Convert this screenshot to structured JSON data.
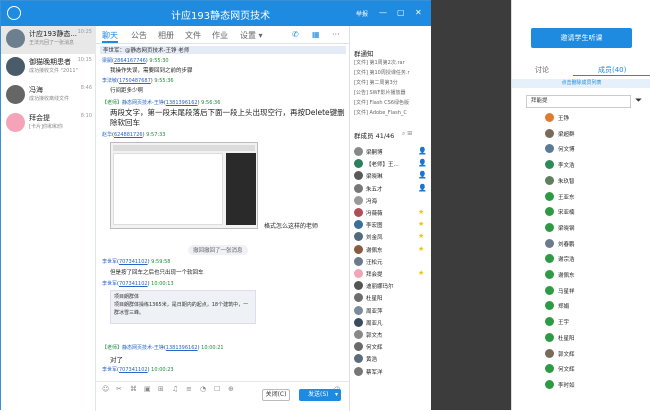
{
  "window": {
    "title": "计应193静态网页技术",
    "status_label": "举报",
    "minimize": "—",
    "maximize": "▢",
    "close": "✕"
  },
  "conversations": [
    {
      "name": "计应193静态...",
      "time": "10:25",
      "preview": "王法元回了一张消息",
      "avatar_color": "#6b7f8f"
    },
    {
      "name": "御猫晚期患者",
      "time": "10:15",
      "preview": "成功接收文件 \"2011\"",
      "avatar_color": "#4a5b6a"
    },
    {
      "name": "冯海",
      "time": "8:46",
      "preview": "成功接收离线文件",
      "avatar_color": "#666666"
    },
    {
      "name": "拜会提",
      "time": "8:10",
      "preview": "[卡片]你和和你",
      "avatar_color": "#f4a3b8"
    }
  ],
  "chat_tabs": [
    "聊天",
    "公告",
    "相册",
    "文件",
    "作业",
    "设置 ▾"
  ],
  "chat_tab_active": 0,
  "announcement": "李世军：@静态网页技术-王铮 老师",
  "messages": [
    {
      "name": "梁嗣",
      "id": "2864167746",
      "time": "9:55:30",
      "text": "我操作失误，需要回到之前的步骤"
    },
    {
      "name": "李法敏",
      "id": "1750487687",
      "time": "9:55:36",
      "text": "行间距多少啊"
    },
    {
      "tag": "【老师】",
      "name": "静态网页技术-王铮",
      "id": "1381396162",
      "time": "9:56:36",
      "text": "两段文字，第一段末尾段落后下面一段上头出现空行，再按Delete键删除软回车"
    },
    {
      "name": "赵华",
      "id": "624881726",
      "time": "9:57:33",
      "text": ""
    },
    {
      "name": "李世军",
      "id": "707341102",
      "time": "9:59:58",
      "text": "但是按了回车之后也只出现一个软回车"
    },
    {
      "name": "李世军",
      "id": "707341102",
      "time": "10:00:13",
      "text": ""
    },
    {
      "tag": "【老师】",
      "name": "静态网页技术-王铮",
      "id": "1381396162",
      "time": "10:00:21",
      "text": "对了"
    },
    {
      "name": "李世军",
      "id": "707341102",
      "time": "10:00:23",
      "text": ""
    }
  ],
  "image_caption": "格式怎么这样的老师",
  "recall_notice": "撤回撤回了一张消息",
  "quote_text_1": "项目朗群体",
  "quote_text_2": "项目朗群体操练1365米，是日期内的起点，18个建筑中，一群冰雪三峰。",
  "toolbar_icons": [
    "☺",
    "✂",
    "⌘",
    "▣",
    "⊞",
    "♫",
    "≡",
    "◔",
    "☐",
    "⊕",
    "◷"
  ],
  "buttons": {
    "close": "关闭(C)",
    "send": "发送(S)"
  },
  "side": {
    "notice_title": "群通知",
    "notices": [
      "[文件] 第1周第2次.rar",
      "[文件] 第10周授课任务.r",
      "[文件] 第二周第3分",
      "[公告] SWF影片播放器",
      "[文件] Flash CS6绿色版",
      "[文件] Adobe_Flash_C"
    ],
    "member_title": "群成员 41/46",
    "members": [
      {
        "name": "梁嗣博",
        "color": "#888888",
        "badge": "👤"
      },
      {
        "name": "【老师】王...",
        "color": "#2d7f5e",
        "badge": "👤"
      },
      {
        "name": "梁晓琳",
        "color": "#5a5a5a",
        "badge": "👤"
      },
      {
        "name": "朱五才",
        "color": "#777777",
        "badge": "👤"
      },
      {
        "name": "冯海",
        "color": "#9a9a9a",
        "badge": ""
      },
      {
        "name": "冯薇薇",
        "color": "#b14d5b",
        "badge": "★"
      },
      {
        "name": "李宏图",
        "color": "#3a6e9b",
        "badge": "★"
      },
      {
        "name": "刘金凤",
        "color": "#4f6b7d",
        "badge": "★"
      },
      {
        "name": "谢佩东",
        "color": "#8a5b3e",
        "badge": "★"
      },
      {
        "name": "汪松元",
        "color": "#6a7b8c",
        "badge": ""
      },
      {
        "name": "拜会提",
        "color": "#f4a3b8",
        "badge": "★"
      },
      {
        "name": "迪丽娜玛尔",
        "color": "#555555",
        "badge": ""
      },
      {
        "name": "杜星阳",
        "color": "#6d6d6d",
        "badge": ""
      },
      {
        "name": "周亚萍",
        "color": "#7d8a9c",
        "badge": ""
      },
      {
        "name": "周亚凡",
        "color": "#3c4b5a",
        "badge": ""
      },
      {
        "name": "郭文杰",
        "color": "#888888",
        "badge": ""
      },
      {
        "name": "何文辉",
        "color": "#6a6a6a",
        "badge": ""
      },
      {
        "name": "黄浩",
        "color": "#5b6c7d",
        "badge": ""
      },
      {
        "name": "蔡军洋",
        "color": "#777777",
        "badge": ""
      }
    ]
  },
  "panel": {
    "invite_button": "邀请学生听课",
    "tab_discuss": "讨论",
    "tab_members": "成员(40)",
    "tip": "点击删除成员列表",
    "search_value": "拜能提",
    "filter_icon": "filter-icon",
    "members": [
      {
        "name": "王铮",
        "color": "#e07b2e"
      },
      {
        "name": "梁超群",
        "color": "#7a6a5a"
      },
      {
        "name": "何文博",
        "color": "#5a7a9a"
      },
      {
        "name": "李文浩",
        "color": "#2e8b57"
      },
      {
        "name": "朱玖智",
        "color": "#5f7f5f"
      },
      {
        "name": "王亚东",
        "color": "#2e9b44"
      },
      {
        "name": "宋亚楠",
        "color": "#2e9b44"
      },
      {
        "name": "梁晓钢",
        "color": "#2e9b44"
      },
      {
        "name": "刘春鹏",
        "color": "#6b7b8b"
      },
      {
        "name": "谢宗浩",
        "color": "#2e9b44"
      },
      {
        "name": "谢佩东",
        "color": "#2e9b44"
      },
      {
        "name": "马星祥",
        "color": "#2e9b44"
      },
      {
        "name": "郑娟",
        "color": "#2e9b44"
      },
      {
        "name": "王宇",
        "color": "#2e9b44"
      },
      {
        "name": "杜星阳",
        "color": "#2e9b44"
      },
      {
        "name": "郭文辉",
        "color": "#7a6a5a"
      },
      {
        "name": "何文辉",
        "color": "#2e9b44"
      },
      {
        "name": "李时如",
        "color": "#2e9b44"
      }
    ]
  }
}
